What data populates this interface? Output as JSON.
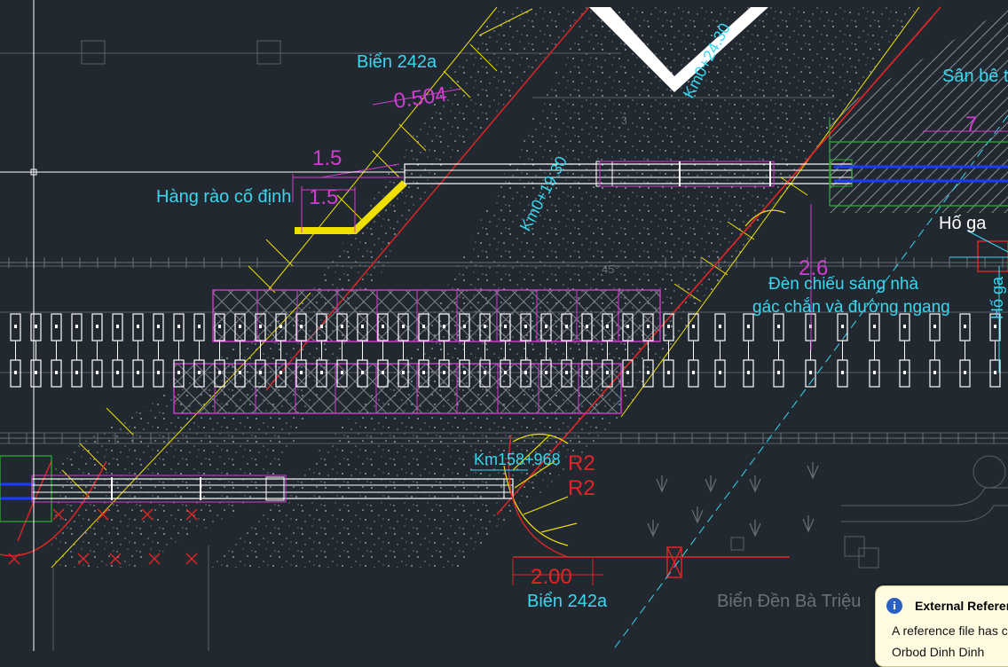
{
  "drawing": {
    "labels": {
      "bien_top": "Biển 242a",
      "dim_0504": "0.504",
      "dim_15a": "1.5",
      "dim_15b": "1.5",
      "hang_rao": "Hàng rào cố định",
      "km_top": "Km0+24.30",
      "km_mid": "Km0+19.30",
      "san_be_tong": "Sân bê tông",
      "dim_7": "7",
      "dim_3": "3",
      "ho_ga": "Hố ga",
      "ho_ga_vert": "Hố ga",
      "den_line1": "Đèn chiếu sáng nhà",
      "den_line2": "gác chắn và đường ngang",
      "dim_26": "2.6",
      "angle_45": "45°",
      "km_bottom": "Km158+968",
      "r2a": "R2",
      "r2b": "R2",
      "dim_200": "2.00",
      "bien_bottom": "Biển 242a",
      "bien_den": "Biển Đền Bà Triệu"
    },
    "colors": {
      "background": "#212830",
      "cyan": "#37d8f0",
      "magenta": "#d23cd2",
      "red": "#e32525",
      "yellow": "#f0e000",
      "white": "#ffffff",
      "green": "#2bb52b",
      "blue": "#1b3cff",
      "grey": "#6b7078"
    }
  },
  "notification": {
    "title": "External Reference",
    "line1": "A reference file has c",
    "line2": "Orbod Dinh Dinh"
  }
}
